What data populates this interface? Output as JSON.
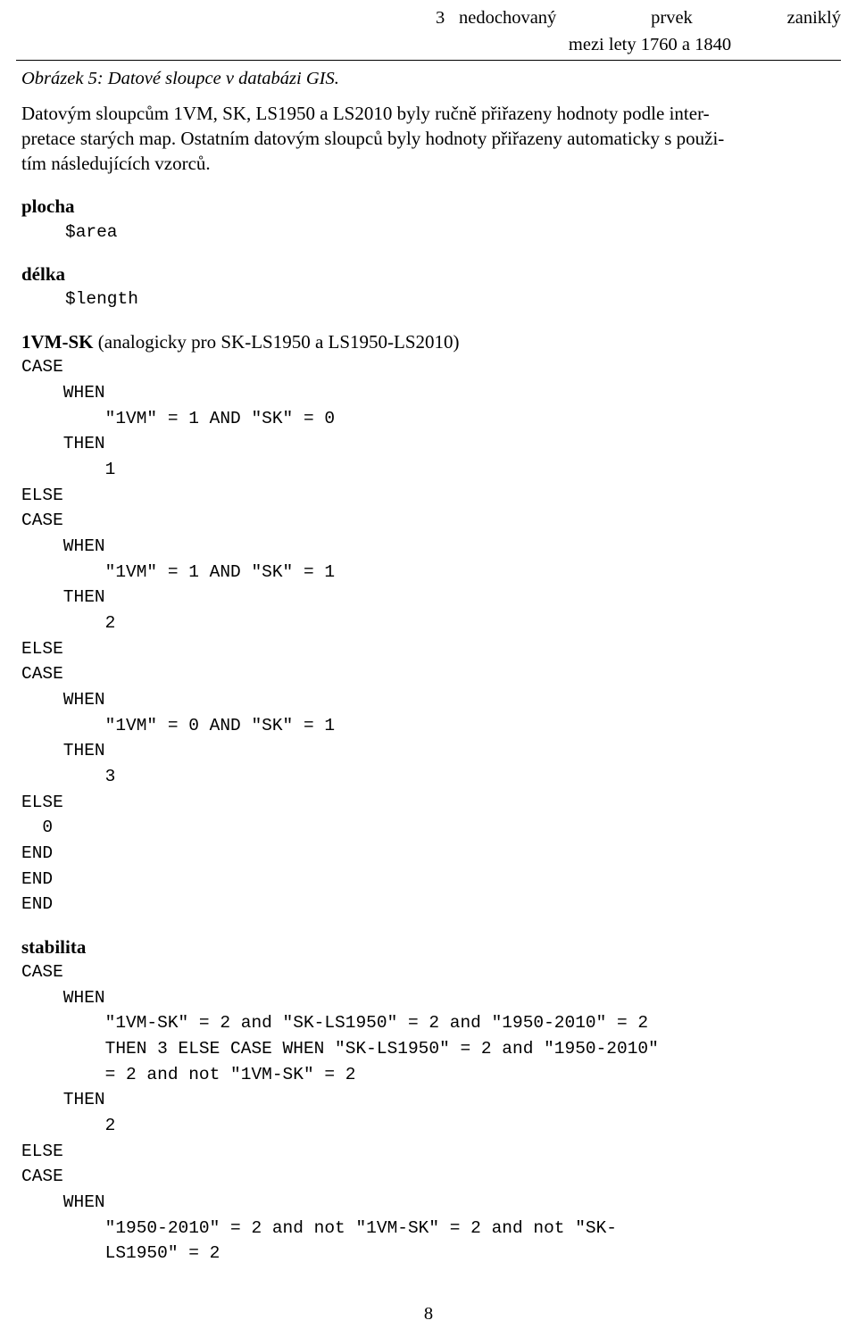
{
  "header": {
    "page_number_top": "3",
    "title_left": "nedochovaný",
    "title_mid": "prvek",
    "title_right": "zaniklý",
    "subtitle": "mezi lety 1760 a 1840"
  },
  "caption": "Obrázek 5: Datové sloupce v databázi GIS.",
  "paragraph": {
    "line1": "Datovým sloupcům 1VM, SK, LS1950 a LS2010 byly ručně přiřazeny hodnoty podle inter-",
    "line2": "pretace starých map. Ostatním datovým sloupců byly hodnoty přiřazeny automaticky s použi-",
    "line3": "tím následujících vzorců."
  },
  "blocks": [
    {
      "title": "plocha",
      "title_suffix": "",
      "code": "$area"
    },
    {
      "title": "délka",
      "title_suffix": "",
      "code": "$length"
    },
    {
      "title": "1VM-SK",
      "title_suffix": " (analogicky pro SK-LS1950 a LS1950-LS2010)",
      "code": "CASE\n    WHEN\n        \"1VM\" = 1 AND \"SK\" = 0\n    THEN\n        1\nELSE\nCASE\n    WHEN\n        \"1VM\" = 1 AND \"SK\" = 1\n    THEN\n        2\nELSE\nCASE\n    WHEN\n        \"1VM\" = 0 AND \"SK\" = 1\n    THEN\n        3\nELSE\n  0\nEND\nEND\nEND"
    },
    {
      "title": "stabilita",
      "title_suffix": "",
      "code": "CASE\n    WHEN\n        \"1VM-SK\" = 2 and \"SK-LS1950\" = 2 and \"1950-2010\" = 2\n        THEN 3 ELSE CASE WHEN \"SK-LS1950\" = 2 and \"1950-2010\"\n        = 2 and not \"1VM-SK\" = 2\n    THEN\n        2\nELSE\nCASE\n    WHEN\n        \"1950-2010\" = 2 and not \"1VM-SK\" = 2 and not \"SK-\n        LS1950\" = 2"
    }
  ],
  "footer": {
    "page_number": "8"
  }
}
